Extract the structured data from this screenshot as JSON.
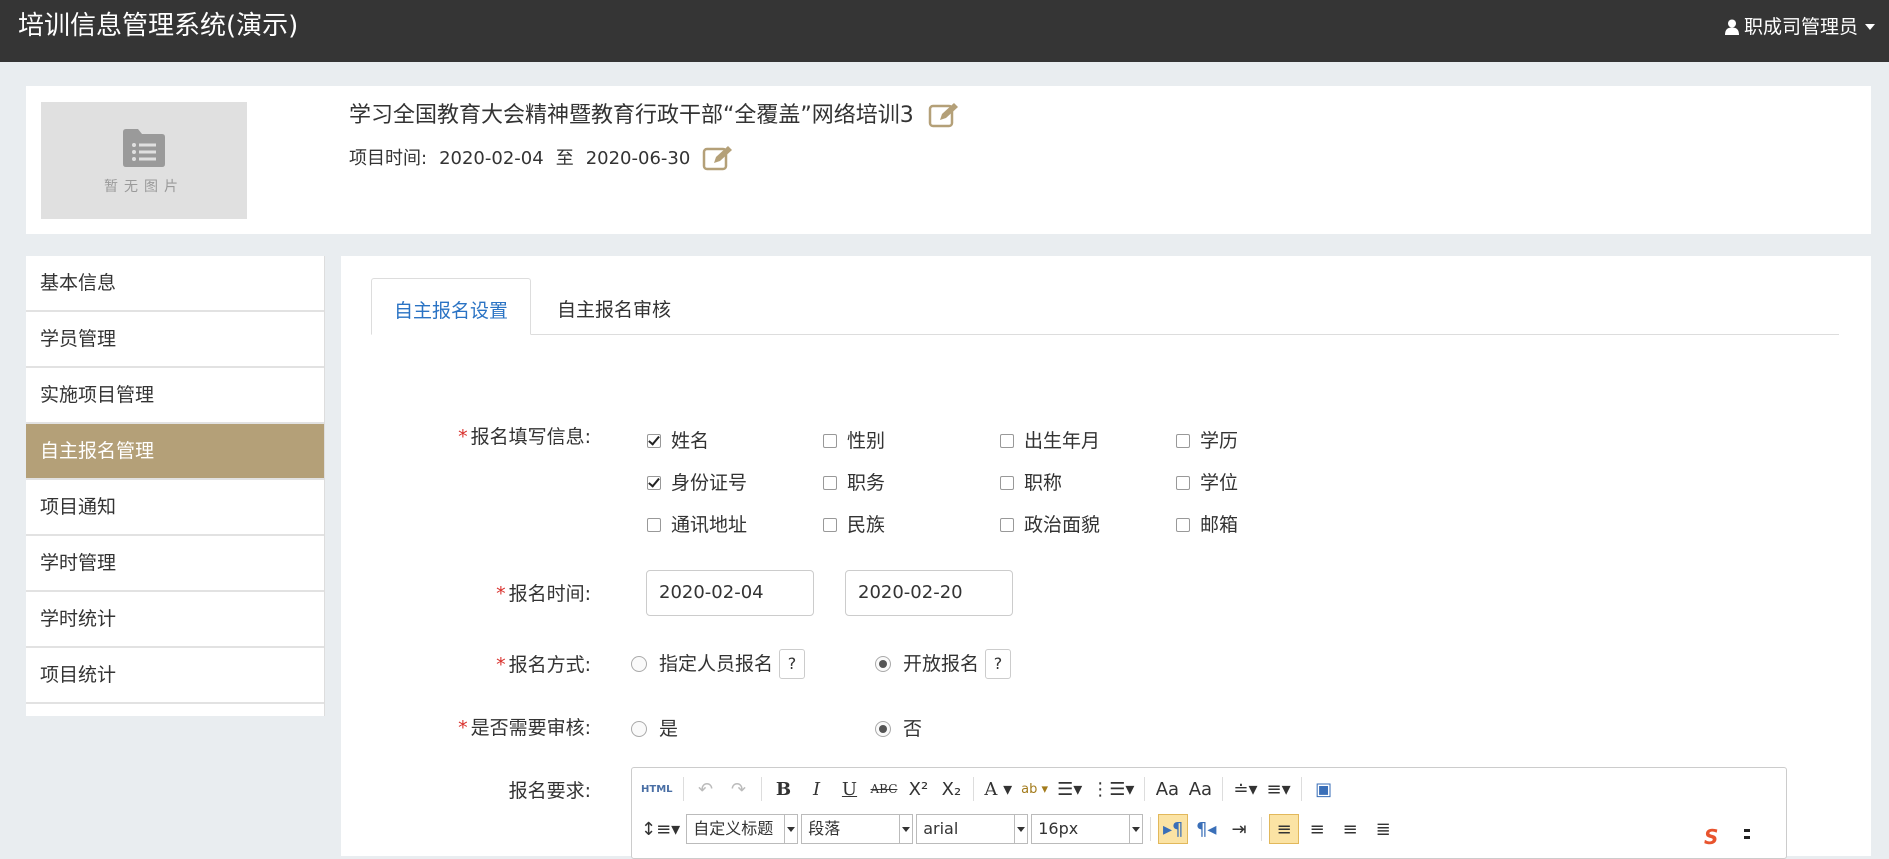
{
  "topbar": {
    "brand": "培训信息管理系统(演示)",
    "user_label": "职成司管理员",
    "user_icon": "user-icon"
  },
  "project": {
    "no_image_text": "暂无图片",
    "title": "学习全国教育大会精神暨教育行政干部“全覆盖”网络培训3",
    "time_label": "项目时间:",
    "time_start": "2020-02-04",
    "time_sep": "至",
    "time_end": "2020-06-30"
  },
  "sidebar": {
    "items": [
      {
        "label": "基本信息",
        "active": false
      },
      {
        "label": "学员管理",
        "active": false
      },
      {
        "label": "实施项目管理",
        "active": false
      },
      {
        "label": "自主报名管理",
        "active": true
      },
      {
        "label": "项目通知",
        "active": false
      },
      {
        "label": "学时管理",
        "active": false
      },
      {
        "label": "学时统计",
        "active": false
      },
      {
        "label": "项目统计",
        "active": false
      }
    ]
  },
  "tabs": {
    "items": [
      {
        "label": "自主报名设置",
        "active": true
      },
      {
        "label": "自主报名审核",
        "active": false
      }
    ]
  },
  "form": {
    "fields_label": "报名填写信息:",
    "fields": [
      {
        "label": "姓名",
        "checked": true
      },
      {
        "label": "性别",
        "checked": false
      },
      {
        "label": "出生年月",
        "checked": false
      },
      {
        "label": "学历",
        "checked": false
      },
      {
        "label": "身份证号",
        "checked": true
      },
      {
        "label": "职务",
        "checked": false
      },
      {
        "label": "职称",
        "checked": false
      },
      {
        "label": "学位",
        "checked": false
      },
      {
        "label": "通讯地址",
        "checked": false
      },
      {
        "label": "民族",
        "checked": false
      },
      {
        "label": "政治面貌",
        "checked": false
      },
      {
        "label": "邮箱",
        "checked": false
      }
    ],
    "time_label": "报名时间:",
    "time_start": "2020-02-04",
    "time_end": "2020-02-20",
    "mode_label": "报名方式:",
    "mode_options": [
      {
        "label": "指定人员报名",
        "selected": false
      },
      {
        "label": "开放报名",
        "selected": true
      }
    ],
    "help_text": "?",
    "review_label": "是否需要审核:",
    "review_options": [
      {
        "label": "是",
        "selected": false
      },
      {
        "label": "否",
        "selected": true
      }
    ],
    "requirement_label": "报名要求:",
    "required_mark": "*"
  },
  "editor": {
    "html_btn": "HTML",
    "bold": "B",
    "italic": "I",
    "underline": "U",
    "strike": "ABC",
    "font_color": "A",
    "highlight": "ab",
    "custom_title": "自定义标题",
    "paragraph": "段落",
    "font_family": "arial",
    "font_size": "16px"
  },
  "colors": {
    "topbar": "#353535",
    "sidebar_active": "#b4a078",
    "tab_active_text": "#2a73c4",
    "required": "#d9302c",
    "edit_icon": "#b4a078"
  }
}
